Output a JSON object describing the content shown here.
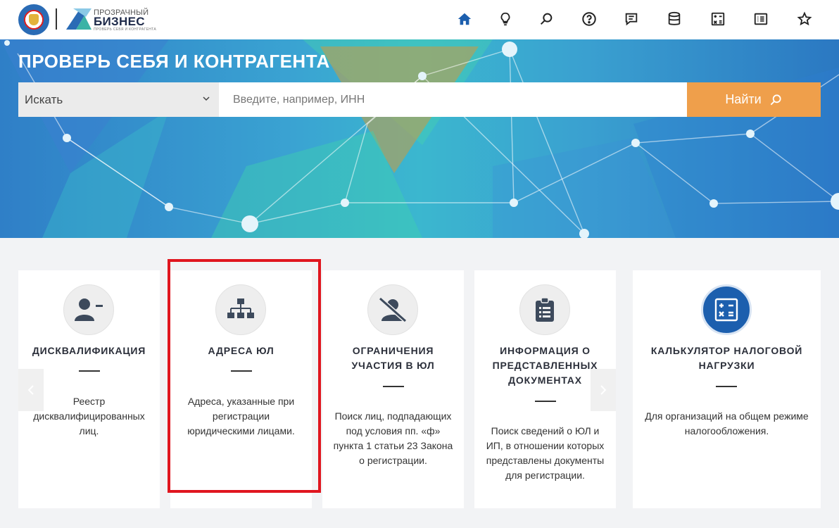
{
  "header": {
    "logo_line1": "ПРОЗРАЧНЫЙ",
    "logo_line2": "БИЗНЕС",
    "logo_line3": "ПРОВЕРЬ СЕБЯ И КОНТРАГЕНТА",
    "nav_icons": [
      "home-icon",
      "lightbulb-icon",
      "search-icon",
      "help-icon",
      "comment-icon",
      "database-icon",
      "calculator-icon",
      "list-icon",
      "star-icon"
    ],
    "active_color": "#1c5fae"
  },
  "hero": {
    "title": "ПРОВЕРЬ СЕБЯ И КОНТРАГЕНТА",
    "select_value": "Искать",
    "search_placeholder": "Введите, например, ИНН",
    "search_button": "Найти"
  },
  "cards": [
    {
      "icon": "user-minus-icon",
      "title": "ДИСКВАЛИФИКАЦИЯ",
      "description": "Реестр дисквалифицированных лиц."
    },
    {
      "icon": "sitemap-icon",
      "title": "АДРЕСА ЮЛ",
      "description": "Адреса, указанные при регистрации юридическими лицами."
    },
    {
      "icon": "user-slash-icon",
      "title": "ОГРАНИЧЕНИЯ УЧАСТИЯ В ЮЛ",
      "description": "Поиск лиц, подпадающих под условия пп. «ф» пункта 1 статьи 23 Закона о регистрации."
    },
    {
      "icon": "clipboard-list-icon",
      "title": "ИНФОРМАЦИЯ О ПРЕДСТАВЛЕННЫХ ДОКУМЕНТАХ",
      "description": "Поиск сведений о ЮЛ и ИП, в отношении которых представлены документы для регистрации."
    },
    {
      "icon": "calculator-icon",
      "title": "КАЛЬКУЛЯТОР НАЛОГОВОЙ НАГРУЗКИ",
      "description": "Для организаций на общем режиме налогообложения."
    }
  ],
  "colors": {
    "accent_orange": "#ef9f4b",
    "brand_blue": "#1c5fae",
    "highlight_red": "#e0161f"
  }
}
